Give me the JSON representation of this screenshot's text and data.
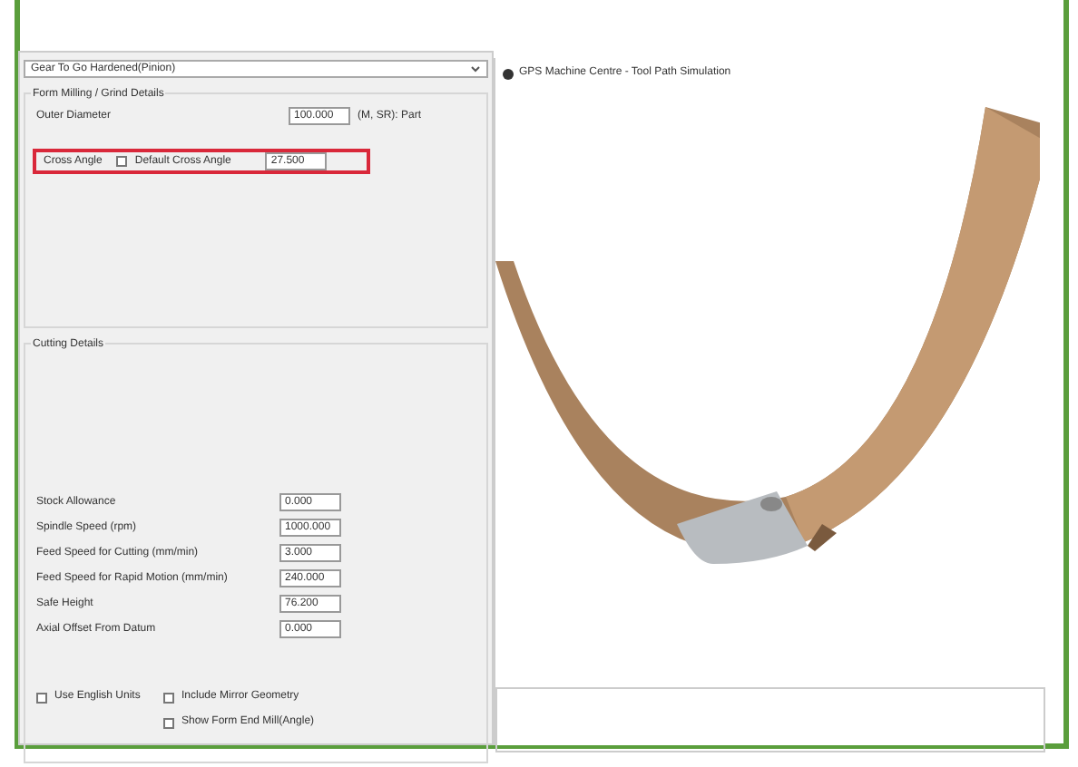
{
  "dropdown": {
    "value": "Gear To Go Hardened(Pinion)"
  },
  "form_details": {
    "title": "Form Milling / Grind Details",
    "outer_diameter": {
      "label": "Outer Diameter",
      "value": "100.000",
      "unit": "(M, SR): Part"
    },
    "cross_angle": {
      "label": "Cross Angle",
      "default_checkbox": {
        "label": "Default Cross Angle",
        "checked": false
      },
      "value": "27.500",
      "highlighted": true
    }
  },
  "cutting_details": {
    "title": "Cutting Details",
    "fields": [
      {
        "label": "Stock Allowance",
        "value": "0.000"
      },
      {
        "label": "Spindle Speed (rpm)",
        "value": "1000.000"
      },
      {
        "label": "Feed Speed for Cutting (mm/min)",
        "value": "3.000"
      },
      {
        "label": "Feed Speed for Rapid Motion (mm/min)",
        "value": "240.000"
      },
      {
        "label": "Safe Height",
        "value": "76.200"
      },
      {
        "label": "Axial Offset From Datum",
        "value": "0.000"
      }
    ],
    "options": [
      {
        "label": "Use English Units",
        "checked": false
      },
      {
        "label": "Include Mirror Geometry",
        "checked": false
      },
      {
        "label": "Show Form End Mill(Angle)",
        "checked": false
      }
    ]
  },
  "viewer": {
    "title": "GPS Machine Centre - Tool Path Simulation"
  }
}
